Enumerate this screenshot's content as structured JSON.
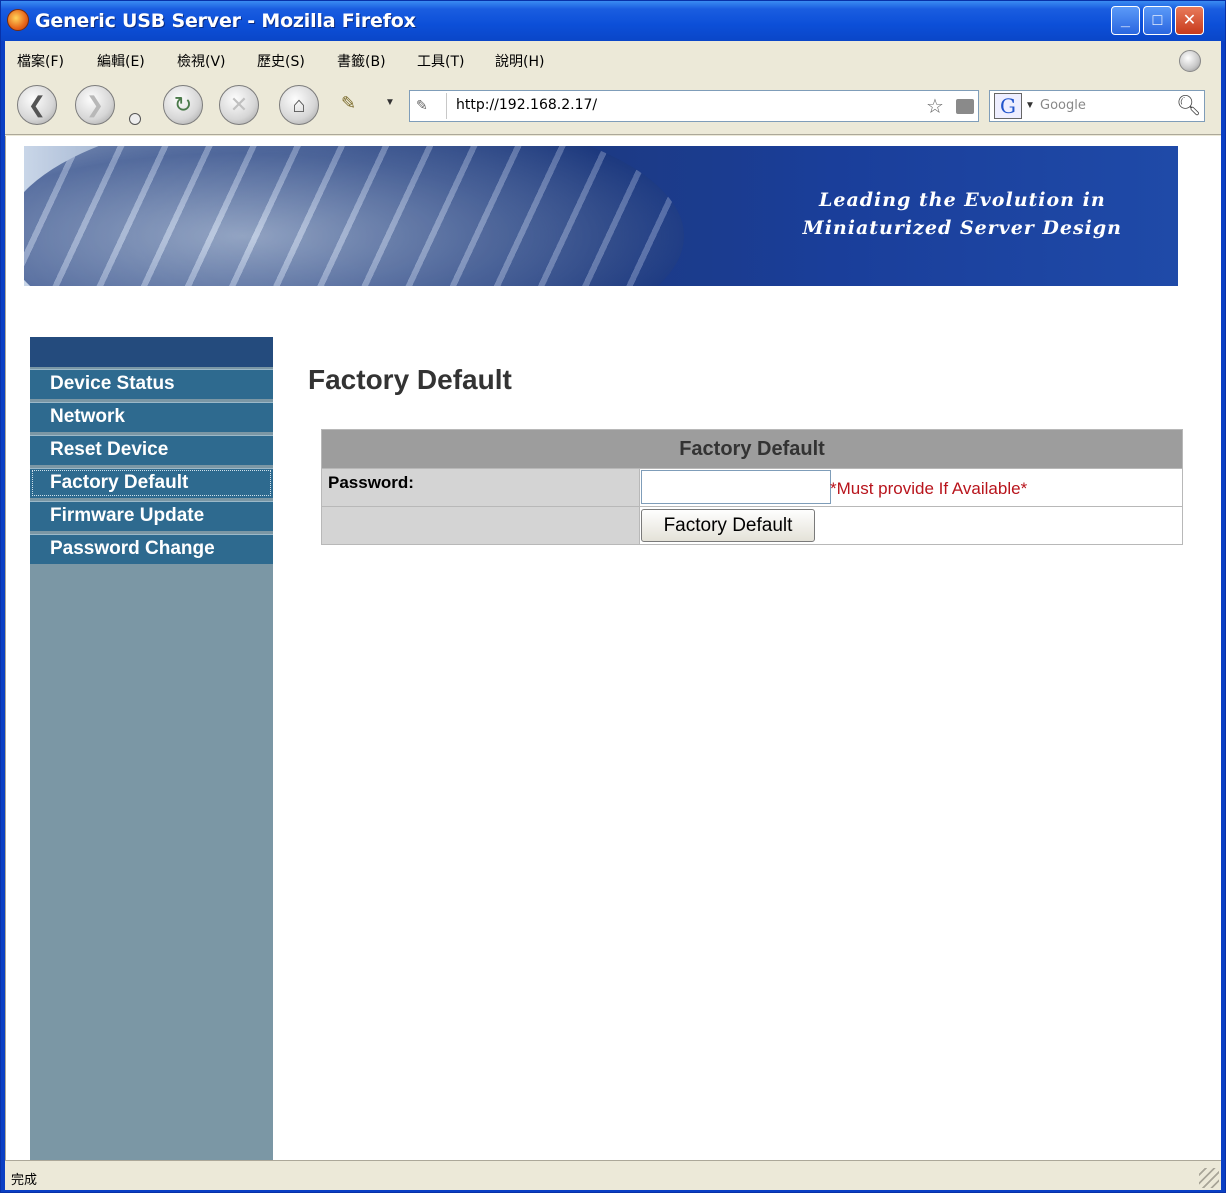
{
  "window": {
    "title": "Generic USB Server - Mozilla Firefox",
    "controls": {
      "minimize": "_",
      "maximize": "□",
      "close": "✕"
    }
  },
  "menubar": {
    "items": [
      "檔案(F)",
      "編輯(E)",
      "檢視(V)",
      "歷史(S)",
      "書籤(B)",
      "工具(T)",
      "說明(H)"
    ]
  },
  "toolbar": {
    "url": "http://192.168.2.17/",
    "search_placeholder": "Google",
    "search_engine": "G",
    "icons": [
      "back-icon",
      "forward-icon",
      "reload-icon",
      "stop-icon",
      "home-icon",
      "history-icon",
      "bookmark-star-icon",
      "feed-icon",
      "search-icon"
    ]
  },
  "banner": {
    "line1": "Leading the Evolution in",
    "line2": "Miniaturized Server Design"
  },
  "sidebar": {
    "items": [
      {
        "label": "Device Status"
      },
      {
        "label": "Network"
      },
      {
        "label": "Reset Device"
      },
      {
        "label": "Factory Default",
        "active": true
      },
      {
        "label": "Firmware Update"
      },
      {
        "label": "Password Change"
      }
    ]
  },
  "main": {
    "title": "Factory Default",
    "table": {
      "header": "Factory Default",
      "password_label": "Password:",
      "password_value": "",
      "password_note": "*Must provide If Available*",
      "submit_label": "Factory Default"
    }
  },
  "statusbar": {
    "text": "完成"
  }
}
